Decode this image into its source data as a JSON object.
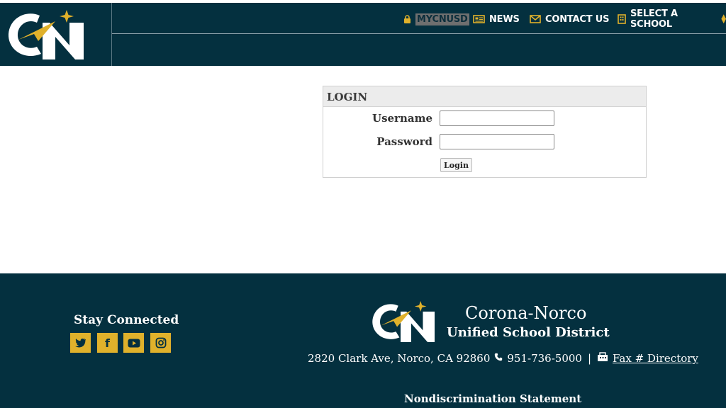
{
  "header": {
    "logo_alt": "CN",
    "nav": {
      "mycnusd": "MYCNUSD",
      "news": "NEWS",
      "contact": "CONTACT US",
      "school": "SELECT A SCHOOL"
    }
  },
  "login": {
    "title": "LOGIN",
    "username_label": "Username",
    "password_label": "Password",
    "username_value": "",
    "password_value": "",
    "button": "Login"
  },
  "footer": {
    "stay_connected": "Stay Connected",
    "social": [
      "twitter-icon",
      "facebook-icon",
      "youtube-icon",
      "instagram-icon"
    ],
    "district_line1": "Corona-Norco",
    "district_line2": "Unified School District",
    "address": "2820 Clark Ave, Norco, CA 92860",
    "phone": "951-736-5000",
    "separator": "|",
    "fax_link": "Fax # Directory",
    "nondiscrimination": "Nondiscrimination Statement"
  },
  "colors": {
    "navy": "#04303f",
    "gold": "#e0b12b"
  }
}
